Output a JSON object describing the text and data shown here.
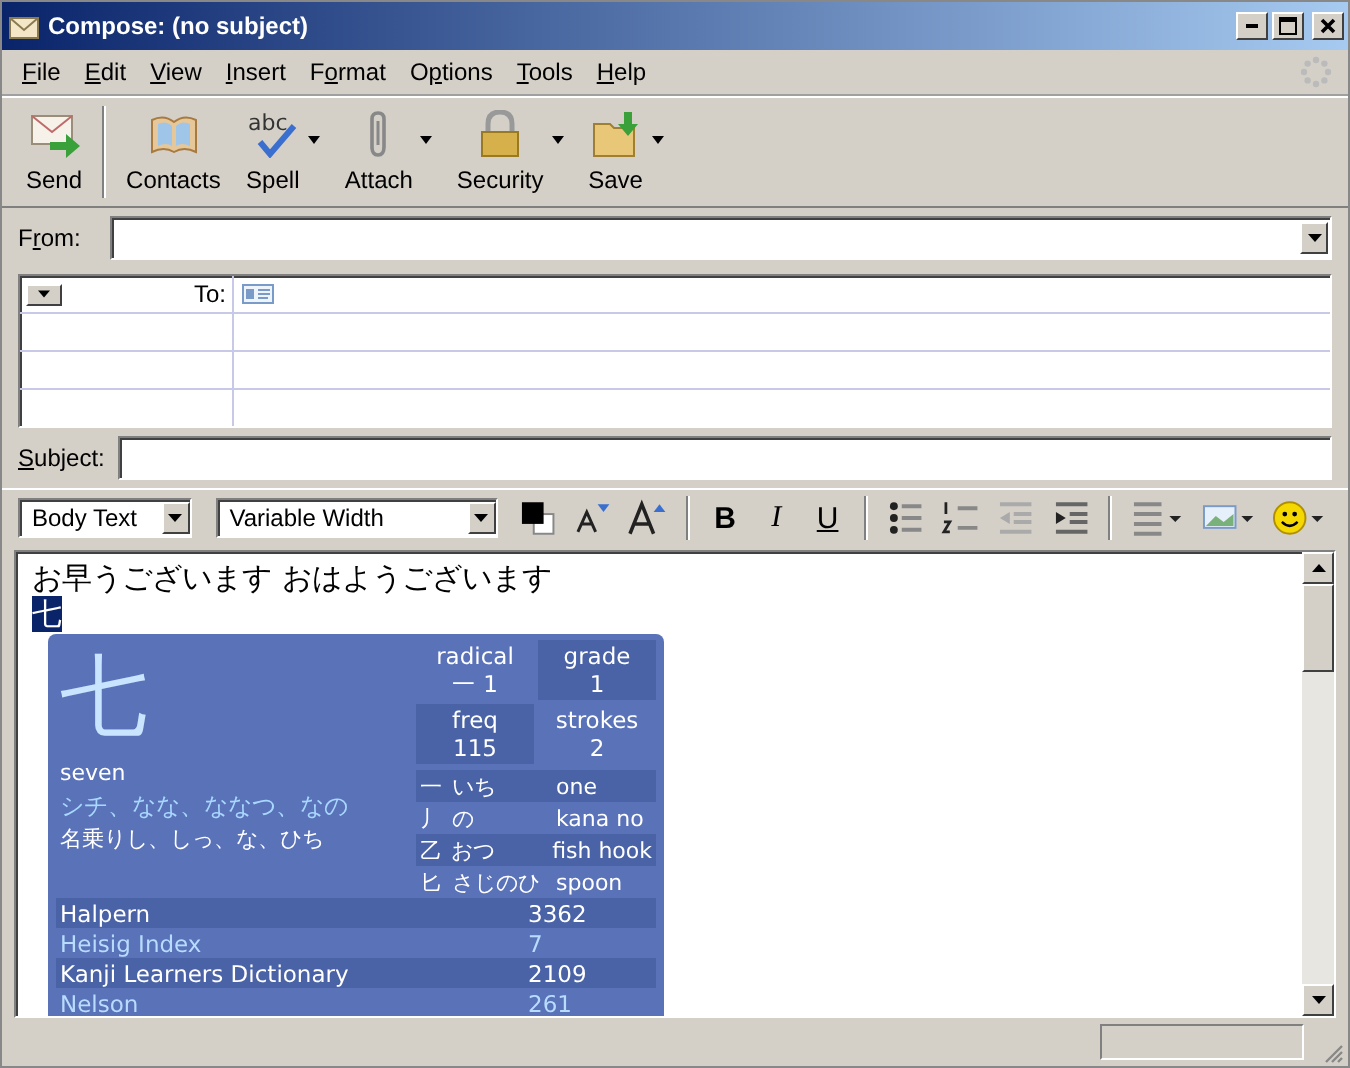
{
  "window": {
    "title": "Compose: (no subject)"
  },
  "menu": [
    {
      "key": "F",
      "after": "ile"
    },
    {
      "key": "E",
      "after": "dit"
    },
    {
      "key": "V",
      "after": "iew"
    },
    {
      "key": "I",
      "after": "nsert"
    },
    {
      "before": "F",
      "key": "o",
      "after": "rmat"
    },
    {
      "before": "O",
      "key": "p",
      "after": "tions"
    },
    {
      "key": "T",
      "after": "ools"
    },
    {
      "key": "H",
      "after": "elp"
    }
  ],
  "toolbar": [
    {
      "label": "Send",
      "kind": "send",
      "dropdown": false
    },
    {
      "label": "Contacts",
      "kind": "contacts",
      "dropdown": false
    },
    {
      "label": "Spell",
      "kind": "spell",
      "icon_text": "abc",
      "dropdown": true
    },
    {
      "label": "Attach",
      "kind": "attach",
      "dropdown": true
    },
    {
      "label": "Security",
      "kind": "security",
      "dropdown": true
    },
    {
      "label": "Save",
      "kind": "save",
      "dropdown": true
    }
  ],
  "from": {
    "before": "F",
    "key": "r",
    "after": "om:"
  },
  "addressing": {
    "type_label": "To:"
  },
  "subject": {
    "key": "S",
    "after": "ubject:"
  },
  "format_bar": {
    "paragraph": "Body Text",
    "font": "Variable Width",
    "styles": [
      {
        "label": "B",
        "kind": "bold"
      },
      {
        "label": "I",
        "kind": "italic"
      },
      {
        "label": "U",
        "kind": "underline"
      }
    ]
  },
  "body": {
    "line_1": "お早うございます おはようございます",
    "selected_char": "七"
  },
  "kanji_popup": {
    "kanji": "七",
    "meaning": "seven",
    "readings": "シチ、なな、ななつ、なの",
    "nanori": "名乗りし、しっ、な、ひち",
    "stats": [
      {
        "label": "radical",
        "value": "一 1"
      },
      {
        "label": "grade",
        "value": "1"
      },
      {
        "label": "freq",
        "value": "115"
      },
      {
        "label": "strokes",
        "value": "2"
      }
    ],
    "components": [
      {
        "char": "一",
        "reading": "いち",
        "meaning": "one"
      },
      {
        "char": "丿",
        "reading": "の",
        "meaning": "kana no"
      },
      {
        "char": "乙",
        "reading": "おつ",
        "meaning": "fish hook"
      },
      {
        "char": "匕",
        "reading": "さじのひ",
        "meaning": "spoon"
      }
    ],
    "references": [
      {
        "name": "Halpern",
        "value": "3362"
      },
      {
        "name": "Heisig Index",
        "value": "7"
      },
      {
        "name": "Kanji Learners Dictionary",
        "value": "2109"
      },
      {
        "name": "Nelson",
        "value": "261"
      }
    ]
  }
}
